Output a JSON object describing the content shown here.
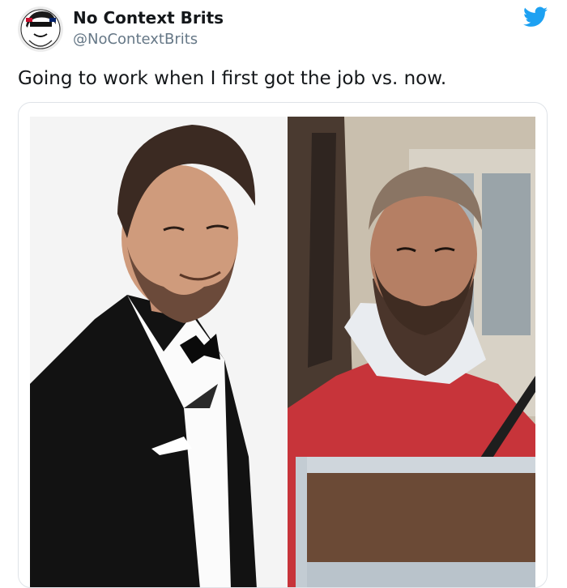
{
  "author": {
    "display_name": "No Context Brits",
    "handle": "@NoContextBrits",
    "avatar_icon": "avatar-face-icon"
  },
  "platform": {
    "logo_icon": "twitter-bird-icon",
    "brand_color": "#1da1f2"
  },
  "tweet": {
    "text": "Going to work when I first got the job vs. now."
  },
  "media": {
    "images": [
      {
        "description_icon": "man-in-tuxedo-photo"
      },
      {
        "description_icon": "man-in-red-sweater-photo"
      }
    ]
  },
  "colors": {
    "text_primary": "#14171a",
    "text_secondary": "#657786",
    "card_border": "#dfe3e8"
  }
}
